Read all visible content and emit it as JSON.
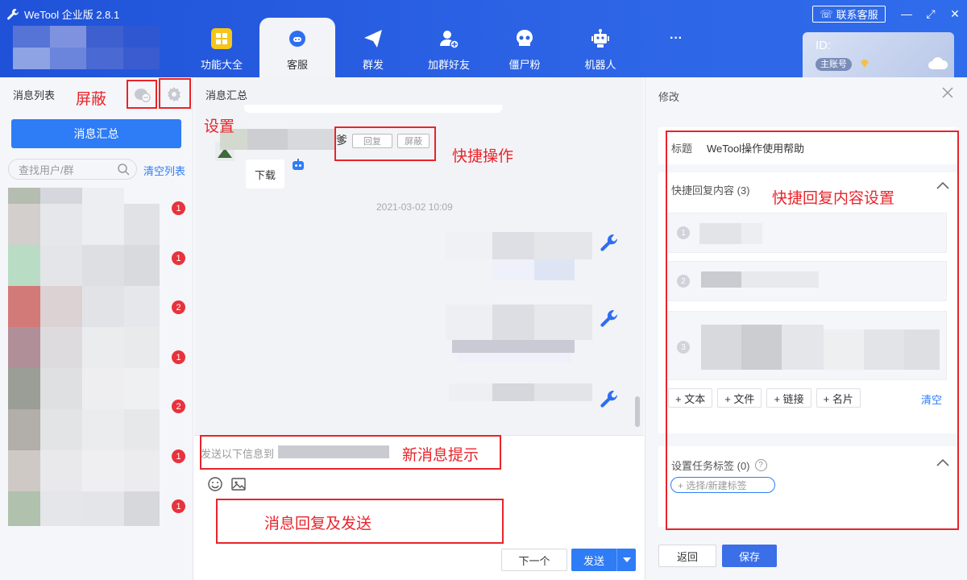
{
  "app": {
    "title": "WeTool 企业版 2.8.1",
    "contact_label": "联系客服"
  },
  "nav": [
    {
      "label": "功能大全",
      "icon": "grid-icon"
    },
    {
      "label": "客服",
      "icon": "headset-icon"
    },
    {
      "label": "群发",
      "icon": "paper-plane-icon"
    },
    {
      "label": "加群好友",
      "icon": "add-user-icon"
    },
    {
      "label": "僵尸粉",
      "icon": "skull-icon"
    },
    {
      "label": "机器人",
      "icon": "robot-icon"
    },
    {
      "label": "···",
      "icon": "more-icon"
    }
  ],
  "account": {
    "id_label": "ID:",
    "role_badge": "主账号"
  },
  "sidebar": {
    "title": "消息列表",
    "summary_button": "消息汇总",
    "search_placeholder": "查找用户/群",
    "clear_label": "清空列表",
    "contacts": [
      {
        "unread": "1",
        "avatar_color": "#d2cfcc"
      },
      {
        "unread": "1",
        "avatar_color": "#b8dcc4"
      },
      {
        "unread": "2",
        "avatar_color": "#d27a78"
      },
      {
        "unread": "1",
        "avatar_color": "#b08f98"
      },
      {
        "unread": "2",
        "avatar_color": "#9a9e96"
      },
      {
        "unread": "1",
        "avatar_color": "#b2aea9"
      },
      {
        "unread": "1",
        "avatar_color": "#cfc9c6"
      }
    ]
  },
  "middle": {
    "title": "消息汇总",
    "chat": {
      "sender_suffix": "爹",
      "reply_button": "回复",
      "block_button": "屏蔽",
      "download_text": "下载",
      "timestamp": "2021-03-02 10:09"
    },
    "notice_prefix": "发送以下信息到",
    "next_button": "下一个",
    "send_button": "发送"
  },
  "right": {
    "title": "修改",
    "field_title_label": "标题",
    "field_title_value": "WeTool操作使用帮助",
    "quick_reply_label": "快捷回复内容 (3)",
    "items": [
      "1",
      "2",
      "3"
    ],
    "actions": [
      "+ 文本",
      "+ 文件",
      "+ 链接",
      "+ 名片"
    ],
    "clear_label": "清空",
    "tag_label": "设置任务标签 (0)",
    "tag_placeholder": "+ 选择/新建标签",
    "back_button": "返回",
    "save_button": "保存"
  },
  "annotations": {
    "block": "屏蔽",
    "settings": "设置",
    "quick_ops": "快捷操作",
    "new_msg": "新消息提示",
    "reply_send": "消息回复及发送",
    "quick_reply_settings": "快捷回复内容设置"
  },
  "colors": {
    "header_blue": "#2d64e6",
    "accent_blue": "#2e7cf6",
    "annotation_red": "#e8242a",
    "badge_red": "#e8323c"
  }
}
